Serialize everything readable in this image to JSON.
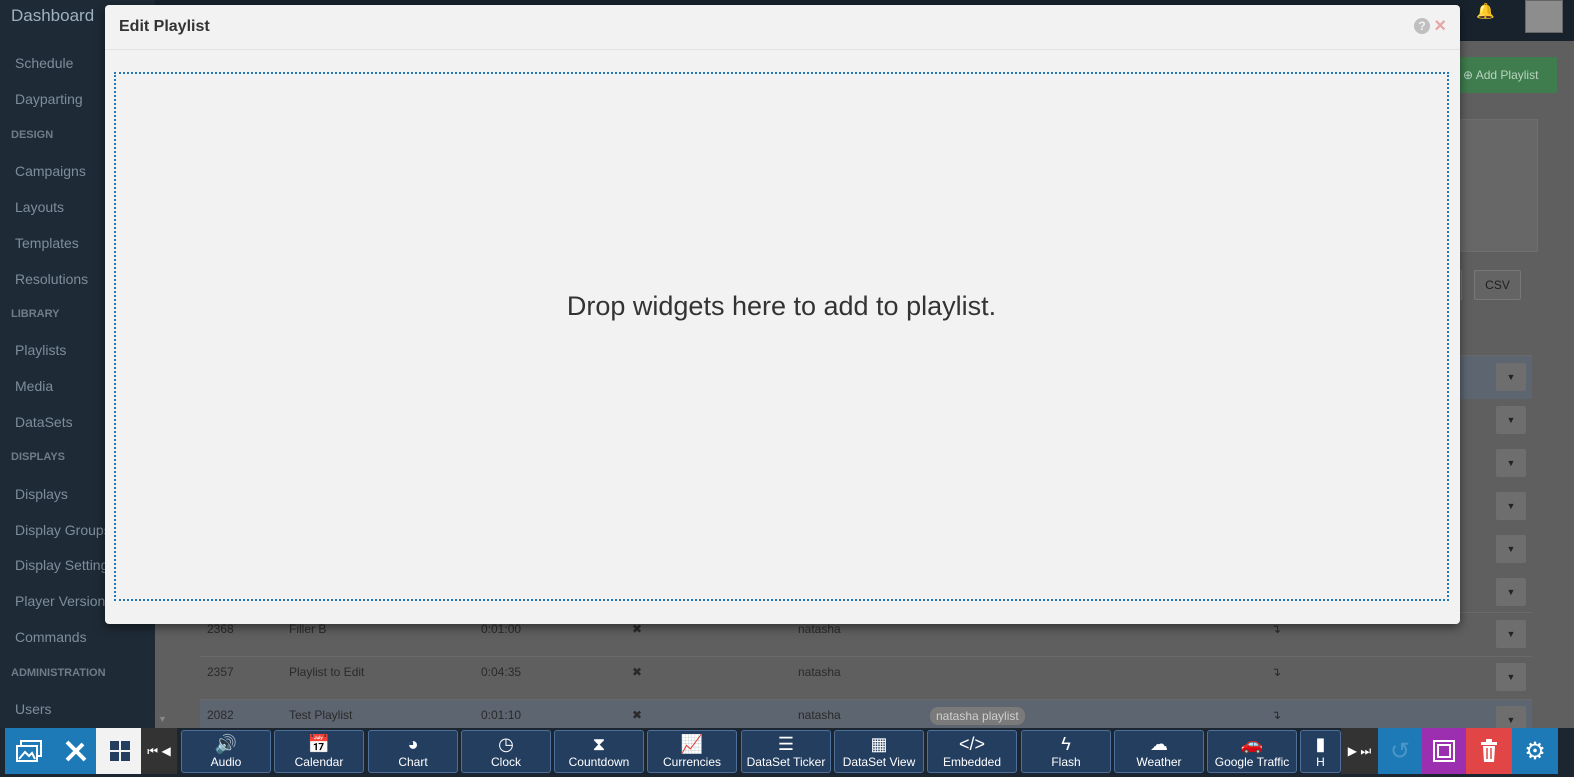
{
  "sidebar": {
    "brand": "Dashboard",
    "items": [
      {
        "type": "item",
        "label": "Schedule"
      },
      {
        "type": "item",
        "label": "Dayparting"
      },
      {
        "type": "head",
        "label": "DESIGN"
      },
      {
        "type": "item",
        "label": "Campaigns"
      },
      {
        "type": "item",
        "label": "Layouts"
      },
      {
        "type": "item",
        "label": "Templates"
      },
      {
        "type": "item",
        "label": "Resolutions"
      },
      {
        "type": "head",
        "label": "LIBRARY"
      },
      {
        "type": "item",
        "label": "Playlists"
      },
      {
        "type": "item",
        "label": "Media"
      },
      {
        "type": "item",
        "label": "DataSets"
      },
      {
        "type": "head",
        "label": "DISPLAYS"
      },
      {
        "type": "item",
        "label": "Displays"
      },
      {
        "type": "item",
        "label": "Display Groups"
      },
      {
        "type": "item",
        "label": "Display Settings"
      },
      {
        "type": "item",
        "label": "Player Versions"
      },
      {
        "type": "item",
        "label": "Commands"
      },
      {
        "type": "head",
        "label": "ADMINISTRATION"
      },
      {
        "type": "item",
        "label": "Users"
      }
    ]
  },
  "background": {
    "add_playlist_label": "Add Playlist",
    "csv_label": "CSV",
    "rows": [
      {
        "id": "2368",
        "name": "Filler B",
        "duration": "0:01:00",
        "owner": "natasha"
      },
      {
        "id": "2357",
        "name": "Playlist to Edit",
        "duration": "0:04:35",
        "owner": "natasha"
      },
      {
        "id": "2082",
        "name": "Test Playlist",
        "duration": "0:01:10",
        "owner": "natasha"
      }
    ],
    "tag": "natasha playlist"
  },
  "modal": {
    "title": "Edit Playlist",
    "dropzone_text": "Drop widgets here to add to playlist."
  },
  "toolbar": {
    "widgets": [
      {
        "label": "Audio",
        "icon": "audio-icon",
        "glyph": "🔊"
      },
      {
        "label": "Calendar",
        "icon": "calendar-icon",
        "glyph": "📅"
      },
      {
        "label": "Chart",
        "icon": "chart-pie-icon",
        "glyph": "◕"
      },
      {
        "label": "Clock",
        "icon": "clock-icon",
        "glyph": "◷"
      },
      {
        "label": "Countdown",
        "icon": "hourglass-icon",
        "glyph": "⧗"
      },
      {
        "label": "Currencies",
        "icon": "line-chart-icon",
        "glyph": "📈"
      },
      {
        "label": "DataSet Ticker",
        "icon": "list-icon",
        "glyph": "☰"
      },
      {
        "label": "DataSet View",
        "icon": "table-icon",
        "glyph": "▦"
      },
      {
        "label": "Embedded",
        "icon": "code-icon",
        "glyph": "</>"
      },
      {
        "label": "Flash",
        "icon": "flash-icon",
        "glyph": "ϟ"
      },
      {
        "label": "Weather",
        "icon": "cloud-icon",
        "glyph": "☁"
      },
      {
        "label": "Google Traffic",
        "icon": "car-icon",
        "glyph": "🚗"
      },
      {
        "label": "H",
        "icon": "h-icon",
        "glyph": "▮"
      }
    ]
  },
  "colors": {
    "dropzone_border": "#2478b8",
    "toolbar_blue": "#1d7ab7",
    "purple": "#9b2fb0",
    "red": "#e24545",
    "widget_bg": "#243e60"
  }
}
